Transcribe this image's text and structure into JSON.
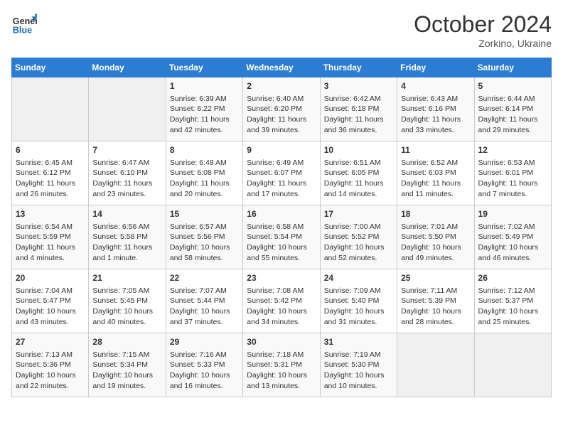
{
  "header": {
    "logo_line1": "General",
    "logo_line2": "Blue",
    "month": "October 2024",
    "location": "Zorkino, Ukraine"
  },
  "weekdays": [
    "Sunday",
    "Monday",
    "Tuesday",
    "Wednesday",
    "Thursday",
    "Friday",
    "Saturday"
  ],
  "weeks": [
    [
      {
        "day": "",
        "sunrise": "",
        "sunset": "",
        "daylight": ""
      },
      {
        "day": "",
        "sunrise": "",
        "sunset": "",
        "daylight": ""
      },
      {
        "day": "1",
        "sunrise": "Sunrise: 6:39 AM",
        "sunset": "Sunset: 6:22 PM",
        "daylight": "Daylight: 11 hours and 42 minutes."
      },
      {
        "day": "2",
        "sunrise": "Sunrise: 6:40 AM",
        "sunset": "Sunset: 6:20 PM",
        "daylight": "Daylight: 11 hours and 39 minutes."
      },
      {
        "day": "3",
        "sunrise": "Sunrise: 6:42 AM",
        "sunset": "Sunset: 6:18 PM",
        "daylight": "Daylight: 11 hours and 36 minutes."
      },
      {
        "day": "4",
        "sunrise": "Sunrise: 6:43 AM",
        "sunset": "Sunset: 6:16 PM",
        "daylight": "Daylight: 11 hours and 33 minutes."
      },
      {
        "day": "5",
        "sunrise": "Sunrise: 6:44 AM",
        "sunset": "Sunset: 6:14 PM",
        "daylight": "Daylight: 11 hours and 29 minutes."
      }
    ],
    [
      {
        "day": "6",
        "sunrise": "Sunrise: 6:45 AM",
        "sunset": "Sunset: 6:12 PM",
        "daylight": "Daylight: 11 hours and 26 minutes."
      },
      {
        "day": "7",
        "sunrise": "Sunrise: 6:47 AM",
        "sunset": "Sunset: 6:10 PM",
        "daylight": "Daylight: 11 hours and 23 minutes."
      },
      {
        "day": "8",
        "sunrise": "Sunrise: 6:48 AM",
        "sunset": "Sunset: 6:08 PM",
        "daylight": "Daylight: 11 hours and 20 minutes."
      },
      {
        "day": "9",
        "sunrise": "Sunrise: 6:49 AM",
        "sunset": "Sunset: 6:07 PM",
        "daylight": "Daylight: 11 hours and 17 minutes."
      },
      {
        "day": "10",
        "sunrise": "Sunrise: 6:51 AM",
        "sunset": "Sunset: 6:05 PM",
        "daylight": "Daylight: 11 hours and 14 minutes."
      },
      {
        "day": "11",
        "sunrise": "Sunrise: 6:52 AM",
        "sunset": "Sunset: 6:03 PM",
        "daylight": "Daylight: 11 hours and 11 minutes."
      },
      {
        "day": "12",
        "sunrise": "Sunrise: 6:53 AM",
        "sunset": "Sunset: 6:01 PM",
        "daylight": "Daylight: 11 hours and 7 minutes."
      }
    ],
    [
      {
        "day": "13",
        "sunrise": "Sunrise: 6:54 AM",
        "sunset": "Sunset: 5:59 PM",
        "daylight": "Daylight: 11 hours and 4 minutes."
      },
      {
        "day": "14",
        "sunrise": "Sunrise: 6:56 AM",
        "sunset": "Sunset: 5:58 PM",
        "daylight": "Daylight: 11 hours and 1 minute."
      },
      {
        "day": "15",
        "sunrise": "Sunrise: 6:57 AM",
        "sunset": "Sunset: 5:56 PM",
        "daylight": "Daylight: 10 hours and 58 minutes."
      },
      {
        "day": "16",
        "sunrise": "Sunrise: 6:58 AM",
        "sunset": "Sunset: 5:54 PM",
        "daylight": "Daylight: 10 hours and 55 minutes."
      },
      {
        "day": "17",
        "sunrise": "Sunrise: 7:00 AM",
        "sunset": "Sunset: 5:52 PM",
        "daylight": "Daylight: 10 hours and 52 minutes."
      },
      {
        "day": "18",
        "sunrise": "Sunrise: 7:01 AM",
        "sunset": "Sunset: 5:50 PM",
        "daylight": "Daylight: 10 hours and 49 minutes."
      },
      {
        "day": "19",
        "sunrise": "Sunrise: 7:02 AM",
        "sunset": "Sunset: 5:49 PM",
        "daylight": "Daylight: 10 hours and 46 minutes."
      }
    ],
    [
      {
        "day": "20",
        "sunrise": "Sunrise: 7:04 AM",
        "sunset": "Sunset: 5:47 PM",
        "daylight": "Daylight: 10 hours and 43 minutes."
      },
      {
        "day": "21",
        "sunrise": "Sunrise: 7:05 AM",
        "sunset": "Sunset: 5:45 PM",
        "daylight": "Daylight: 10 hours and 40 minutes."
      },
      {
        "day": "22",
        "sunrise": "Sunrise: 7:07 AM",
        "sunset": "Sunset: 5:44 PM",
        "daylight": "Daylight: 10 hours and 37 minutes."
      },
      {
        "day": "23",
        "sunrise": "Sunrise: 7:08 AM",
        "sunset": "Sunset: 5:42 PM",
        "daylight": "Daylight: 10 hours and 34 minutes."
      },
      {
        "day": "24",
        "sunrise": "Sunrise: 7:09 AM",
        "sunset": "Sunset: 5:40 PM",
        "daylight": "Daylight: 10 hours and 31 minutes."
      },
      {
        "day": "25",
        "sunrise": "Sunrise: 7:11 AM",
        "sunset": "Sunset: 5:39 PM",
        "daylight": "Daylight: 10 hours and 28 minutes."
      },
      {
        "day": "26",
        "sunrise": "Sunrise: 7:12 AM",
        "sunset": "Sunset: 5:37 PM",
        "daylight": "Daylight: 10 hours and 25 minutes."
      }
    ],
    [
      {
        "day": "27",
        "sunrise": "Sunrise: 7:13 AM",
        "sunset": "Sunset: 5:36 PM",
        "daylight": "Daylight: 10 hours and 22 minutes."
      },
      {
        "day": "28",
        "sunrise": "Sunrise: 7:15 AM",
        "sunset": "Sunset: 5:34 PM",
        "daylight": "Daylight: 10 hours and 19 minutes."
      },
      {
        "day": "29",
        "sunrise": "Sunrise: 7:16 AM",
        "sunset": "Sunset: 5:33 PM",
        "daylight": "Daylight: 10 hours and 16 minutes."
      },
      {
        "day": "30",
        "sunrise": "Sunrise: 7:18 AM",
        "sunset": "Sunset: 5:31 PM",
        "daylight": "Daylight: 10 hours and 13 minutes."
      },
      {
        "day": "31",
        "sunrise": "Sunrise: 7:19 AM",
        "sunset": "Sunset: 5:30 PM",
        "daylight": "Daylight: 10 hours and 10 minutes."
      },
      {
        "day": "",
        "sunrise": "",
        "sunset": "",
        "daylight": ""
      },
      {
        "day": "",
        "sunrise": "",
        "sunset": "",
        "daylight": ""
      }
    ]
  ]
}
